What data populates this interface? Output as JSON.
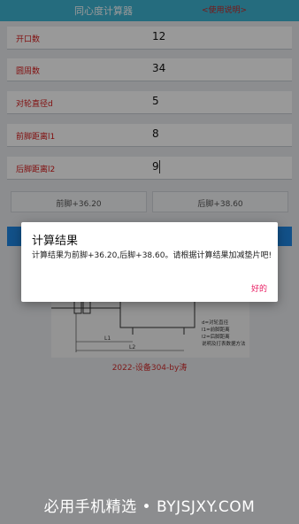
{
  "app": {
    "title": "同心度计算器",
    "help_link": "<使用说明>"
  },
  "fields": [
    {
      "label": "开口数",
      "value": "12"
    },
    {
      "label": "圆周数",
      "value": "34"
    },
    {
      "label": "对轮直径d",
      "value": "5"
    },
    {
      "label": "前脚距离l1",
      "value": "8"
    },
    {
      "label": "后脚距离l2",
      "value": "9"
    }
  ],
  "results": {
    "front_label": "前脚+36.20",
    "rear_label": "后脚+38.60"
  },
  "figure": {
    "legend": [
      "d=对轮直径",
      "l1=前脚距离",
      "l2=后脚距离",
      "说明及打表数据方法"
    ],
    "dim_l1": "L1",
    "dim_l2": "L2"
  },
  "credit": "2022-设备304-by涛",
  "watermark": "必用手机精选 • BYJSJXY.COM",
  "dialog": {
    "title": "计算结果",
    "message": "计算结果为前脚+36.20,后脚+38.60。请根据计算结果加减垫片吧!",
    "ok_label": "好的"
  },
  "colors": {
    "header": "#3eb5d3",
    "label_red": "#d81b1b",
    "calc_button": "#1e88e5",
    "dialog_ok": "#e91e63"
  }
}
